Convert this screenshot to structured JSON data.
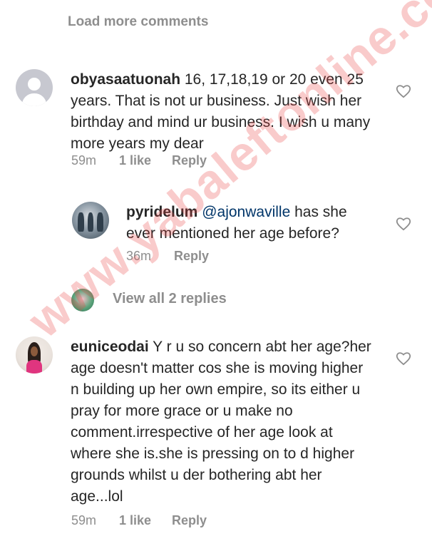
{
  "load_more_label": "Load more comments",
  "comments": [
    {
      "username": "obyasaatuonah",
      "text": " 16, 17,18,19 or 20 even 25 years. That is not ur business. Just wish her birthday and mind ur business. I wish u many more years my dear",
      "time": "59m",
      "likes": "1 like",
      "reply_label": "Reply"
    },
    {
      "username": "pyridelum",
      "mention": "@ajonwaville",
      "text": " has she ever mentioned her age before?",
      "time": "36m",
      "reply_label": "Reply"
    },
    {
      "username": "euniceodai",
      "text": " Y r u so concern abt her age?her age doesn't matter cos she is moving higher n building up her own empire, so its either u pray for more grace or u  make no comment.irrespective of her age look at where she is.she is pressing on to d higher grounds whilst u der bothering abt her age...lol",
      "time": "59m",
      "likes": "1 like",
      "reply_label": "Reply"
    }
  ],
  "view_replies_label": "View all 2 replies",
  "watermark": "www.yabaleftonline.com",
  "colors": {
    "text": "#262626",
    "muted": "#8e8e8e",
    "mention": "#003569",
    "watermark": "#e84646"
  },
  "icons": [
    "heart-outline-icon",
    "default-avatar-icon"
  ]
}
